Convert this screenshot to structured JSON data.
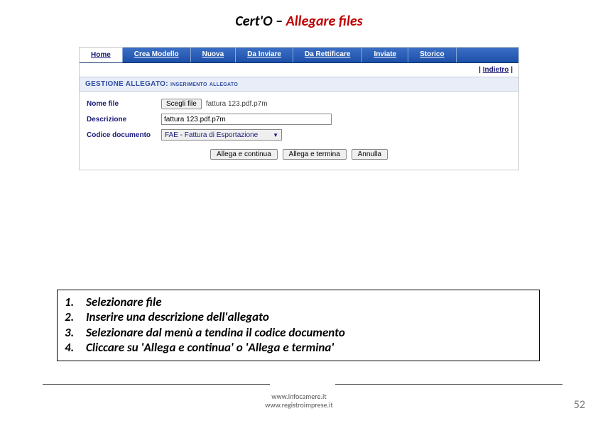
{
  "title": {
    "prefix": "Cert'O – ",
    "highlight": "Allegare files"
  },
  "nav": {
    "items": [
      "Home",
      "Crea Modello",
      "Nuova",
      "Da Inviare",
      "Da Rettificare",
      "Inviate",
      "Storico"
    ]
  },
  "back": {
    "sep": "|",
    "label": "Indietro"
  },
  "section": {
    "title": "GESTIONE ALLEGATO: inserimento allegato"
  },
  "form": {
    "nome_label": "Nome file",
    "choose_btn": "Scegli file",
    "chosen_file": "fattura 123.pdf.p7m",
    "descr_label": "Descrizione",
    "descr_value": "fattura 123.pdf.p7m",
    "codice_label": "Codice documento",
    "codice_value": "FAE - Fattura di Esportazione"
  },
  "buttons": {
    "continua": "Allega e continua",
    "termina": "Allega e termina",
    "annulla": "Annulla"
  },
  "instructions": [
    {
      "n": "1.",
      "t": "Selezionare file"
    },
    {
      "n": "2.",
      "t": "Inserire una descrizione dell'allegato"
    },
    {
      "n": "3.",
      "t": "Selezionare dal menù a tendina il codice documento"
    },
    {
      "n": "4.",
      "t": "Cliccare su 'Allega e continua' o 'Allega e termina'"
    }
  ],
  "footer": {
    "url1": "www.infocamere.it",
    "url2": "www.registroimprese.it"
  },
  "page": "52"
}
